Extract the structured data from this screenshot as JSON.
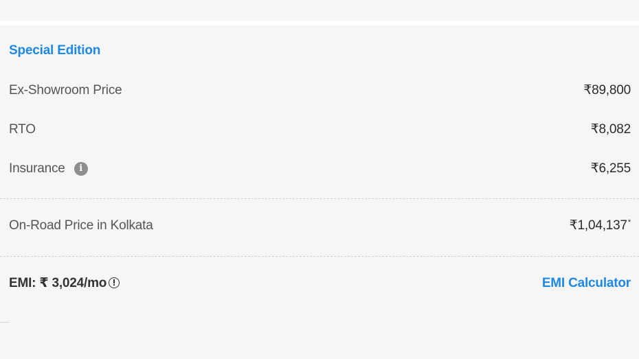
{
  "variant": {
    "title": "Special Edition"
  },
  "price_rows": [
    {
      "label": "Ex-Showroom Price",
      "value": "₹89,800"
    },
    {
      "label": "RTO",
      "value": "₹8,082"
    },
    {
      "label": "Insurance",
      "value": "₹6,255"
    }
  ],
  "on_road": {
    "label": "On-Road Price in Kolkata",
    "value": "₹1,04,137",
    "asterisk": "*"
  },
  "emi": {
    "label": "EMI: ₹ 3,024/mo",
    "calculator_label": "EMI Calculator"
  },
  "icons": {
    "insurance_info": "info-icon",
    "emi_info": "info-circle-icon"
  },
  "colors": {
    "accent": "#1e88e5",
    "background": "#f6f6f6",
    "text": "#2b2b2b",
    "muted_text": "#555555"
  }
}
